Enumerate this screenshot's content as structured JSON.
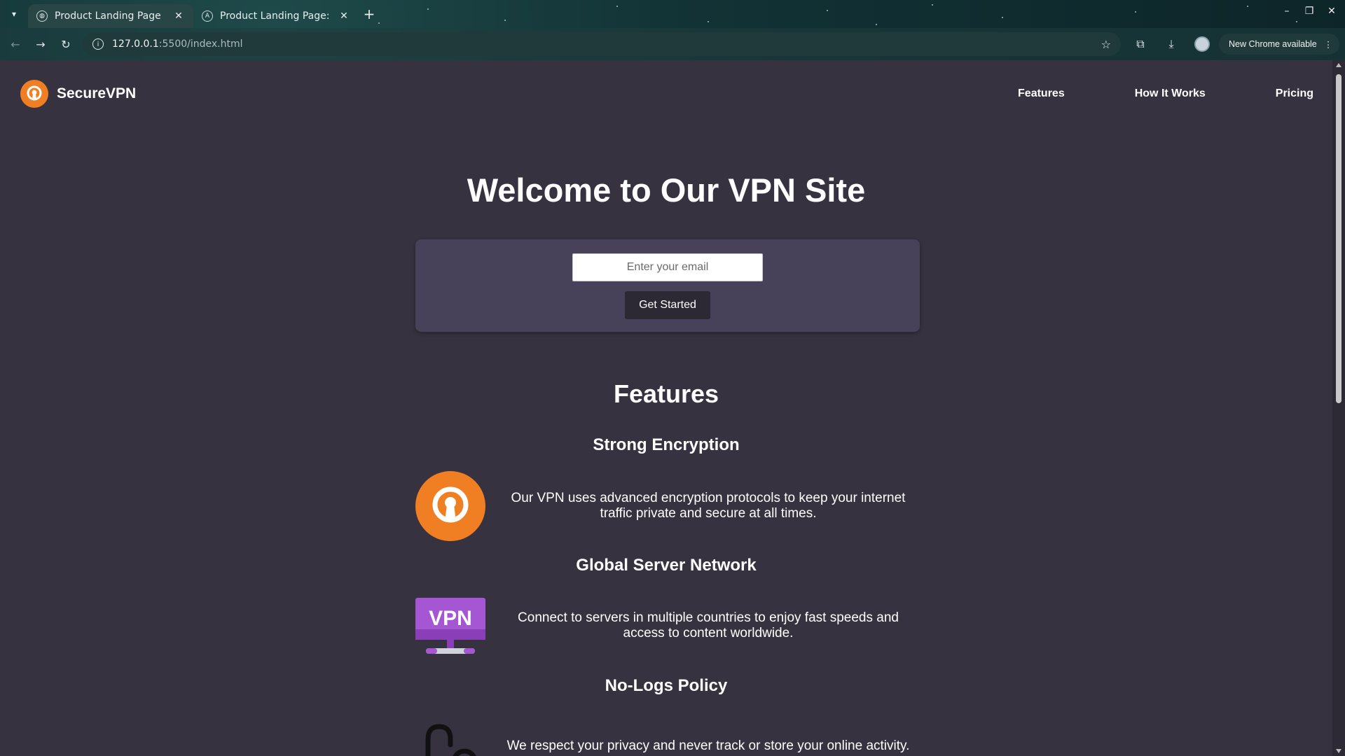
{
  "browser": {
    "tabs": [
      {
        "title": "Product Landing Page",
        "active": true
      },
      {
        "title": "Product Landing Page: Bu",
        "active": false
      }
    ],
    "address": {
      "host": "127.0.0.1",
      "path": ":5500/index.html"
    },
    "update_chip": "New Chrome available"
  },
  "site": {
    "brand": "SecureVPN",
    "nav": [
      "Features",
      "How It Works",
      "Pricing"
    ],
    "hero_title": "Welcome to Our VPN Site",
    "email_placeholder": "Enter your email",
    "cta_label": "Get Started",
    "features_title": "Features",
    "features": [
      {
        "title": "Strong Encryption",
        "text": "Our VPN uses advanced encryption protocols to keep your internet traffic private and secure at all times.",
        "icon": "openvpn-lock-icon"
      },
      {
        "title": "Global Server Network",
        "text": "Connect to servers in multiple countries to enjoy fast speeds and access to content worldwide.",
        "icon": "vpn-monitor-icon"
      },
      {
        "title": "No-Logs Policy",
        "text": "We respect your privacy and never track or store your online activity.",
        "icon": "privacy-lock-icon"
      }
    ],
    "colors": {
      "accent_orange": "#ef7f22",
      "vpn_purple": "#9b4fc8",
      "page_bg": "#36323f",
      "form_bg": "#47425a"
    }
  }
}
